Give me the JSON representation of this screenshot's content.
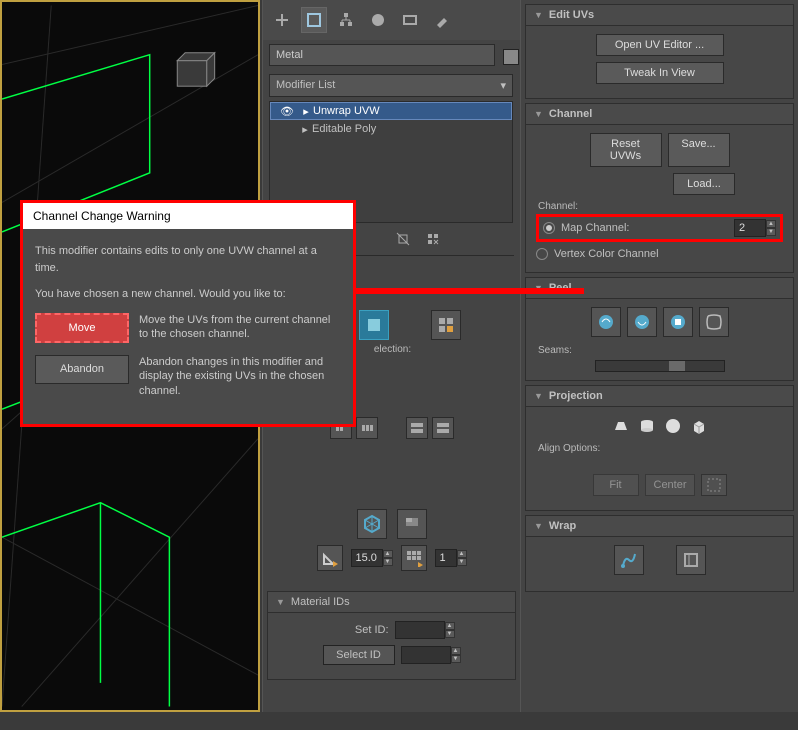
{
  "object_name": "Metal",
  "modifier_list_label": "Modifier List",
  "stack": {
    "item_selected": "Unwrap UVW",
    "item_below": "Editable Poly"
  },
  "dialog": {
    "title": "Channel Change Warning",
    "line1": "This modifier contains edits to only one UVW channel at a time.",
    "line2": "You have chosen a new channel. Would you like to:",
    "move_label": "Move",
    "move_desc": "Move the UVs from the current channel to the chosen channel.",
    "abandon_label": "Abandon",
    "abandon_desc": "Abandon changes in this modifier and display the existing UVs in the chosen channel."
  },
  "rollups": {
    "edit_uvs": {
      "title": "Edit UVs",
      "open_editor": "Open UV Editor ...",
      "tweak": "Tweak In View"
    },
    "channel": {
      "title": "Channel",
      "reset": "Reset UVWs",
      "save": "Save...",
      "load": "Load...",
      "channel_label": "Channel:",
      "map_channel_label": "Map Channel:",
      "map_channel_value": "2",
      "vertex_color": "Vertex Color Channel"
    },
    "peel": {
      "title": "Peel",
      "seams_label": "Seams:"
    },
    "projection": {
      "title": "Projection",
      "align_label": "Align Options:",
      "fit": "Fit",
      "center": "Center"
    },
    "wrap": {
      "title": "Wrap"
    },
    "material_ids": {
      "title": "Material IDs",
      "set_id": "Set ID:",
      "select_id": "Select ID"
    }
  },
  "middle": {
    "selection_label": "election:",
    "spinner15": "15.0",
    "spinner1": "1"
  }
}
